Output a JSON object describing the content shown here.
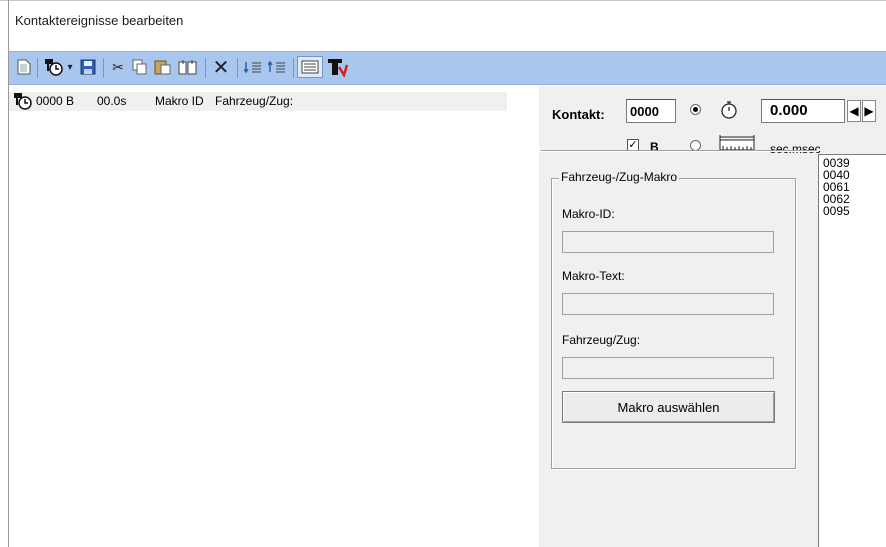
{
  "window": {
    "title": "Kontaktereignisse bearbeiten"
  },
  "toolbar": {
    "buttons": [
      {
        "name": "new-document-icon",
        "glyph": "📄"
      },
      {
        "name": "contact-event-icon",
        "glyph": "🕓"
      },
      {
        "name": "dropdown-arrow-icon",
        "glyph": "▾"
      },
      {
        "name": "save-icon",
        "glyph": "💾"
      },
      {
        "name": "cut-icon",
        "glyph": "✂"
      },
      {
        "name": "copy-icon",
        "glyph": "⧉"
      },
      {
        "name": "paste-icon",
        "glyph": "📋"
      },
      {
        "name": "paste-special-icon",
        "glyph": "⎘"
      },
      {
        "name": "delete-icon",
        "glyph": "✕"
      },
      {
        "name": "move-down-icon",
        "glyph": "⇊"
      },
      {
        "name": "move-up-icon",
        "glyph": "⇈"
      },
      {
        "name": "list-view-icon",
        "glyph": "▤"
      },
      {
        "name": "text-format-icon",
        "glyph": "T"
      }
    ]
  },
  "event_list": {
    "rows": [
      {
        "icon": "contact-event-icon",
        "contact": "0000 B",
        "time": "00.0s",
        "col_macro": "Makro ID",
        "col_vehicle": "Fahrzeug/Zug:"
      }
    ]
  },
  "contact_panel": {
    "kontakt_label": "Kontakt:",
    "kontakt_value": "0000",
    "b_label": "B",
    "b_checked": true,
    "time_value": "0.000",
    "time_unit": "sec.msec",
    "radio_timer_selected": true
  },
  "macro_group": {
    "legend": "Fahrzeug-/Zug-Makro",
    "macro_id_label": "Makro-ID:",
    "macro_id_value": "",
    "macro_text_label": "Makro-Text:",
    "macro_text_value": "",
    "vehicle_label": "Fahrzeug/Zug:",
    "vehicle_value": "",
    "select_button": "Makro auswählen"
  },
  "id_list": [
    "0039",
    "0040",
    "0061",
    "0062",
    "0095"
  ]
}
